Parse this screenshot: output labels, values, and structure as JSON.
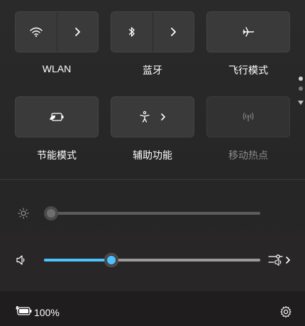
{
  "tiles": [
    {
      "label": "WLAN",
      "icon": "wifi-icon",
      "has_chevron": true,
      "enabled": true
    },
    {
      "label": "蓝牙",
      "icon": "bluetooth-icon",
      "has_chevron": true,
      "enabled": true
    },
    {
      "label": "飞行模式",
      "icon": "airplane-icon",
      "has_chevron": false,
      "enabled": true
    },
    {
      "label": "节能模式",
      "icon": "battery-saver-icon",
      "has_chevron": false,
      "enabled": true
    },
    {
      "label": "辅助功能",
      "icon": "accessibility-icon",
      "has_chevron": true,
      "enabled": true
    },
    {
      "label": "移动热点",
      "icon": "hotspot-icon",
      "has_chevron": false,
      "enabled": false
    }
  ],
  "pager": {
    "pages": 2,
    "current": 1
  },
  "brightness": {
    "icon": "brightness-icon",
    "value": 0.0
  },
  "volume": {
    "icon": "speaker-icon",
    "value": 0.31,
    "output_icon": "audio-output-icon"
  },
  "footer": {
    "battery_icon": "battery-charging-icon",
    "battery_text": "100%",
    "settings_icon": "gear-icon"
  },
  "colors": {
    "accent": "#4cc2ff",
    "panel": "#272727",
    "tile": "#3a3a3a",
    "disabled_text": "#8a8a8a"
  }
}
